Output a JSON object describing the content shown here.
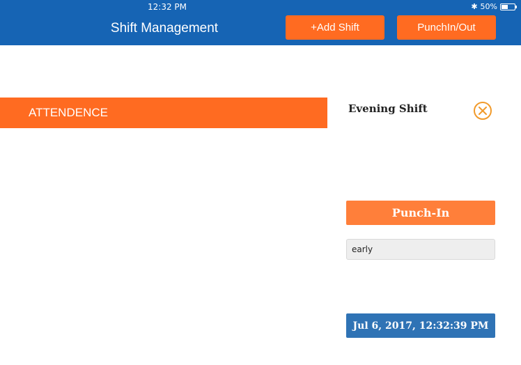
{
  "status_bar": {
    "time": "12:32 PM",
    "battery_percent": "50%",
    "battery_level": 0.5,
    "bluetooth_icon": "bluetooth-icon"
  },
  "nav": {
    "title": "Shift Management",
    "add_shift_label": "+Add Shift",
    "punch_label": "PunchIn/Out"
  },
  "attendence": {
    "label": "ATTENDENCE"
  },
  "shift_panel": {
    "title": "Evening Shift",
    "close_icon": "close-circle-icon",
    "punch_in_label": "Punch-In",
    "status_value": "early",
    "datetime_label": "Jul 6, 2017, 12:32:39 PM"
  },
  "colors": {
    "header_blue": "#1664b4",
    "accent_orange": "#ff6b21",
    "datetime_blue": "#2f73b5",
    "close_icon_orange": "#f19a2a"
  }
}
